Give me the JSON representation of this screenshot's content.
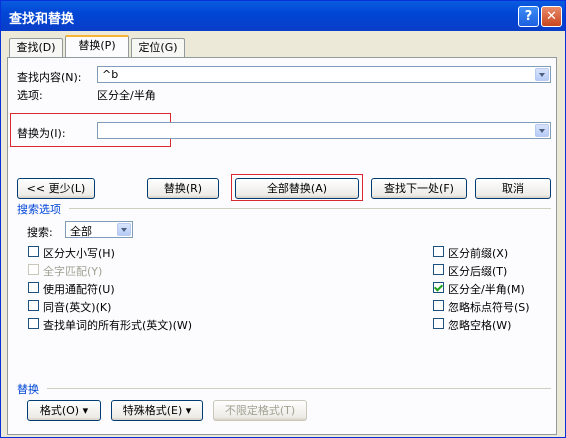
{
  "window": {
    "title": "查找和替换"
  },
  "tabs": [
    {
      "label": "查找(D)"
    },
    {
      "label": "替换(P)"
    },
    {
      "label": "定位(G)"
    }
  ],
  "find": {
    "label": "查找内容(N):",
    "value": "^b",
    "options_label": "选项:",
    "options_value": "区分全/半角"
  },
  "replace": {
    "label": "替换为(I):",
    "value": ""
  },
  "buttons": {
    "less": "<< 更少(L)",
    "replace": "替换(R)",
    "replace_all": "全部替换(A)",
    "find_next": "查找下一处(F)",
    "cancel": "取消"
  },
  "search_options": {
    "group_label": "搜索选项",
    "search_label": "搜索:",
    "search_value": "全部",
    "left": [
      {
        "label": "区分大小写(H)",
        "checked": false,
        "disabled": false
      },
      {
        "label": "全字匹配(Y)",
        "checked": false,
        "disabled": true
      },
      {
        "label": "使用通配符(U)",
        "checked": false,
        "disabled": false
      },
      {
        "label": "同音(英文)(K)",
        "checked": false,
        "disabled": false
      },
      {
        "label": "查找单词的所有形式(英文)(W)",
        "checked": false,
        "disabled": false
      }
    ],
    "right": [
      {
        "label": "区分前缀(X)",
        "checked": false,
        "disabled": false
      },
      {
        "label": "区分后缀(T)",
        "checked": false,
        "disabled": false
      },
      {
        "label": "区分全/半角(M)",
        "checked": true,
        "disabled": false
      },
      {
        "label": "忽略标点符号(S)",
        "checked": false,
        "disabled": false
      },
      {
        "label": "忽略空格(W)",
        "checked": false,
        "disabled": false
      }
    ]
  },
  "replace_group": {
    "label": "替换",
    "format": "格式(O) ▾",
    "special": "特殊格式(E) ▾",
    "no_format": "不限定格式(T)"
  }
}
